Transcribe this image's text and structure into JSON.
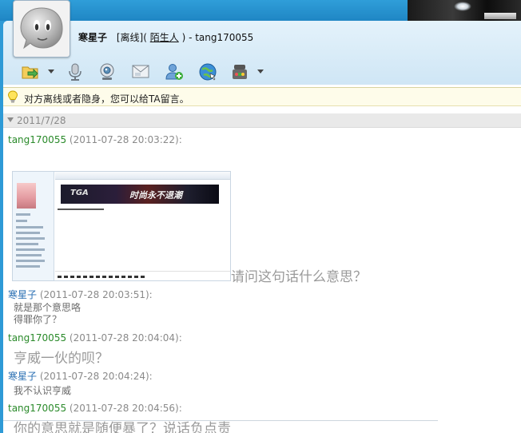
{
  "header": {
    "contact_name": "寒星子",
    "status_prefix": "[离线](",
    "relation": "陌生人",
    "status_suffix": ")",
    "account": "- tang170055"
  },
  "toolbar": {
    "buttons": [
      {
        "name": "file-transfer",
        "has_menu": true
      },
      {
        "name": "voice-chat",
        "has_menu": false
      },
      {
        "name": "video-chat",
        "has_menu": false
      },
      {
        "name": "send-sms",
        "has_menu": false
      },
      {
        "name": "add-friend",
        "has_menu": false
      },
      {
        "name": "web-share",
        "has_menu": false
      },
      {
        "name": "apps",
        "has_menu": true
      }
    ]
  },
  "notice": {
    "text": "对方离线或者隐身，您可以给TA留言。",
    "icon": "lightbulb-icon"
  },
  "chat": {
    "date": "2011/7/28",
    "embedded_image": {
      "banner_text": "时尚永不退潮",
      "logo_text": "TGA"
    },
    "messages": [
      {
        "sender": "tang170055",
        "time": "(2011-07-28 20:03:22):",
        "text": "请问这句话什么意思？",
        "color": "#2a8a2a"
      },
      {
        "sender": "寒星子",
        "time": "(2011-07-28 20:03:51):",
        "text_line1": "就是那个意思咯",
        "text_line2": "得罪你了？",
        "color": "#2a6fb3"
      },
      {
        "sender": "tang170055",
        "time": "(2011-07-28 20:04:04):",
        "text": "亨威一伙的呗？",
        "color": "#2a8a2a"
      },
      {
        "sender": "寒星子",
        "time": "(2011-07-28 20:04:24):",
        "text": "我不认识亨威",
        "color": "#2a6fb3"
      },
      {
        "sender": "tang170055",
        "time": "(2011-07-28 20:04:56):",
        "text": "你的意思就是随便暴了？说话负点责",
        "color": "#2a8a2a"
      }
    ]
  }
}
